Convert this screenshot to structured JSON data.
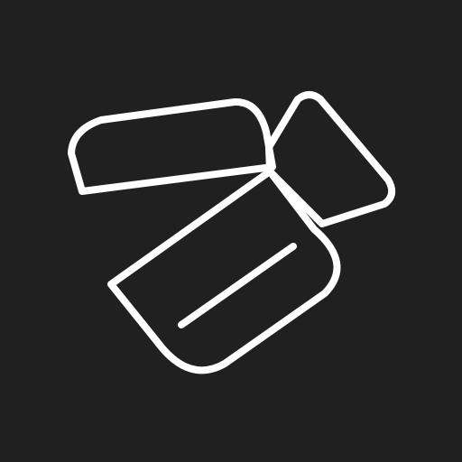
{
  "icon": {
    "name": "video-camera-icon",
    "background_color": "#202020",
    "stroke_color": "#ffffff"
  }
}
